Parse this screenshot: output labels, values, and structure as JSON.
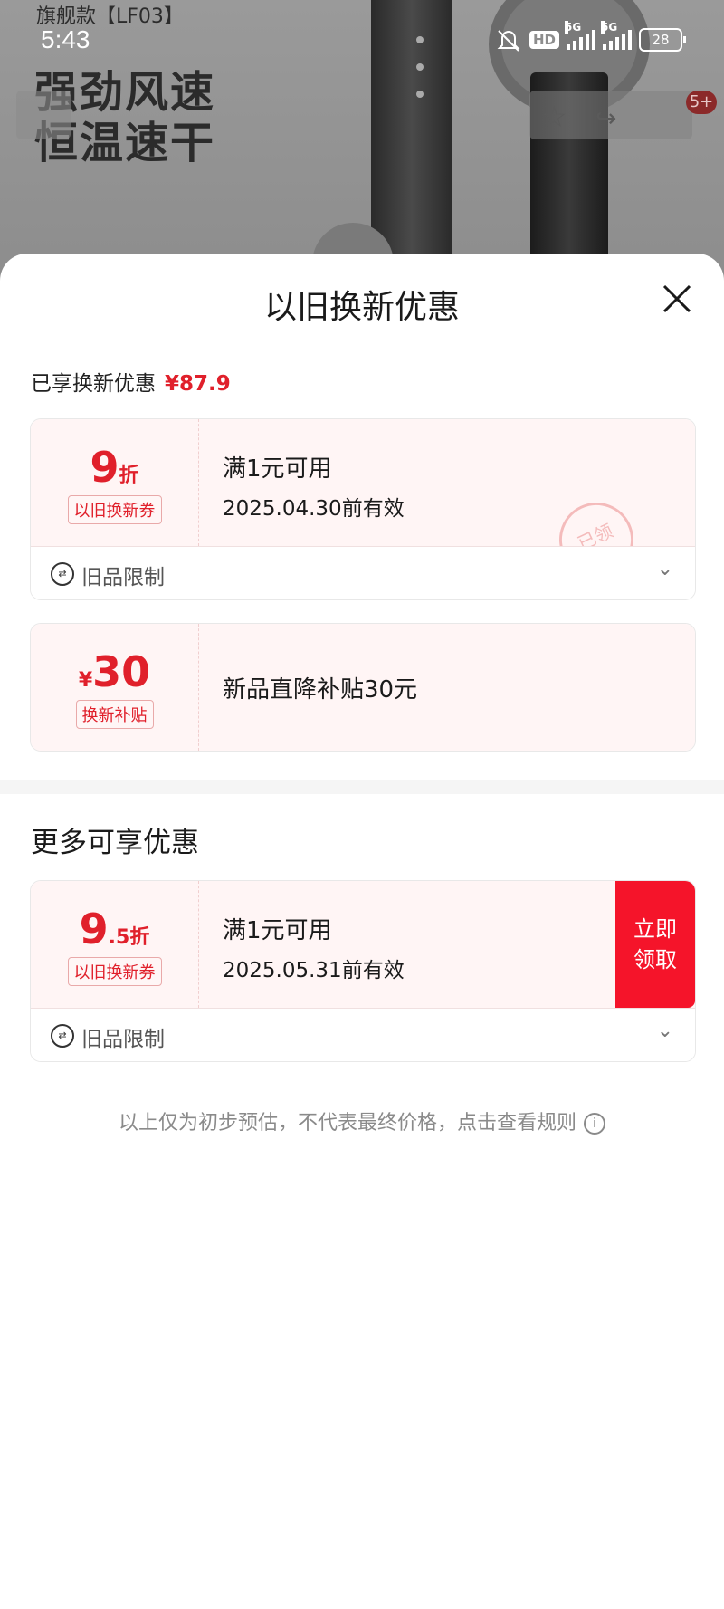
{
  "status_bar": {
    "time": "5:43",
    "hd_badge": "HD",
    "network_1": "5G",
    "network_2": "5G",
    "battery": "28"
  },
  "background": {
    "brand_line": "旗舰款【LF03】",
    "slogan_line1": "强劲风速",
    "slogan_line2": "恒温速干",
    "cart_badge": "5+"
  },
  "sheet": {
    "title": "以旧换新优惠",
    "enjoyed_label": "已享换新优惠",
    "enjoyed_amount": "¥87.9",
    "coupons": [
      {
        "value_big": "9",
        "value_unit": "折",
        "tag": "以旧换新券",
        "condition": "满1元可用",
        "validity": "2025.04.30前有效",
        "stamp": "已领",
        "limit_label": "旧品限制"
      },
      {
        "currency": "¥",
        "value_big": "30",
        "tag": "换新补贴",
        "description": "新品直降补贴30元"
      }
    ],
    "more_title": "更多可享优惠",
    "more_coupons": [
      {
        "value_big": "9",
        "value_small": ".5",
        "value_unit": "折",
        "tag": "以旧换新券",
        "condition": "满1元可用",
        "validity": "2025.05.31前有效",
        "claim_line1": "立即",
        "claim_line2": "领取",
        "limit_label": "旧品限制"
      }
    ],
    "footnote": "以上仅为初步预估，不代表最终价格，点击查看规则"
  },
  "colors": {
    "accent_red": "#e0202b",
    "claim_button": "#f5142a",
    "coupon_bg": "#fff5f5"
  },
  "icons": [
    "close-icon",
    "trade-in-icon",
    "chevron-down-icon",
    "info-icon",
    "star-icon",
    "share-icon"
  ]
}
